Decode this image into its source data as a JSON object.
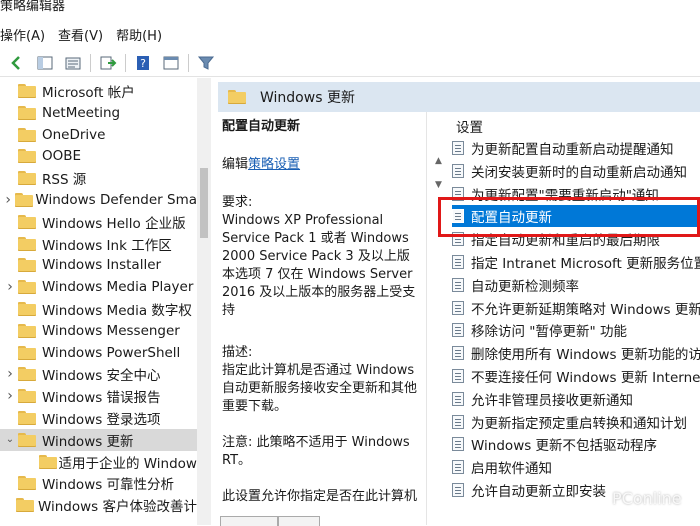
{
  "window": {
    "title": "策略编辑器"
  },
  "menu": [
    "操作(A)",
    "查看(V)",
    "帮助(H)"
  ],
  "toolbar": {
    "icons": [
      "back-icon",
      "forward-icon",
      "up-folder-icon",
      "show-hide-tree-icon",
      "export-list-icon",
      "help-icon",
      "properties-icon",
      "filter-icon"
    ]
  },
  "tree": {
    "items": [
      {
        "label": "Microsoft 帐户",
        "expandable": false,
        "indent": 1
      },
      {
        "label": "NetMeeting",
        "expandable": false,
        "indent": 1
      },
      {
        "label": "OneDrive",
        "expandable": false,
        "indent": 1
      },
      {
        "label": "OOBE",
        "expandable": false,
        "indent": 1
      },
      {
        "label": "RSS 源",
        "expandable": false,
        "indent": 1
      },
      {
        "label": "Windows Defender Sma",
        "expandable": true,
        "indent": 1
      },
      {
        "label": "Windows Hello 企业版",
        "expandable": false,
        "indent": 1
      },
      {
        "label": "Windows Ink 工作区",
        "expandable": false,
        "indent": 1
      },
      {
        "label": "Windows Installer",
        "expandable": false,
        "indent": 1
      },
      {
        "label": "Windows Media Player",
        "expandable": true,
        "indent": 1
      },
      {
        "label": "Windows Media 数字权",
        "expandable": false,
        "indent": 1
      },
      {
        "label": "Windows Messenger",
        "expandable": false,
        "indent": 1
      },
      {
        "label": "Windows PowerShell",
        "expandable": false,
        "indent": 1
      },
      {
        "label": "Windows 安全中心",
        "expandable": true,
        "indent": 1
      },
      {
        "label": "Windows 错误报告",
        "expandable": true,
        "indent": 1
      },
      {
        "label": "Windows 登录选项",
        "expandable": false,
        "indent": 1
      },
      {
        "label": "Windows 更新",
        "expandable": true,
        "expanded": true,
        "indent": 1,
        "selected": true
      },
      {
        "label": "适用于企业的 Window",
        "expandable": false,
        "indent": 2
      },
      {
        "label": "Windows 可靠性分析",
        "expandable": false,
        "indent": 1
      },
      {
        "label": "Windows 客户体验改善计",
        "expandable": false,
        "indent": 1
      }
    ]
  },
  "header": {
    "title": "Windows 更新"
  },
  "description": {
    "title": "配置自动更新",
    "edit_prefix": "编辑",
    "edit_link": "策略设置",
    "requirements_label": "要求:",
    "requirements_text": "Windows XP Professional Service Pack 1 或者 Windows 2000 Service Pack 3 及以上版本选项 7 仅在 Windows Server 2016 及以上版本的服务器上受支持",
    "description_label": "描述:",
    "description_text": "指定此计算机是否通过 Windows 自动更新服务接收安全更新和其他重要下载。",
    "note_text": "注意: 此策略不适用于 Windows RT。",
    "more_text": "此设置允许你指定是否在此计算机"
  },
  "list": {
    "column_header": "设置",
    "items": [
      "为更新配置自动重新启动提醒通知",
      "关闭安装更新时的自动重新启动通知",
      "为更新配置\"需要重新启动\"通知",
      "配置自动更新",
      "指定自动更新和重启的最后期限",
      "指定 Intranet Microsoft 更新服务位置",
      "自动更新检测频率",
      "不允许更新延期策略对 Windows 更新执",
      "移除访问 \"暂停更新\" 功能",
      "删除使用所有 Windows 更新功能的访",
      "不要连接任何 Windows 更新 Internet",
      "允许非管理员接收更新通知",
      "为更新指定预定重启转换和通知计划",
      "Windows 更新不包括驱动程序",
      "启用软件通知",
      "允许自动更新立即安装"
    ],
    "selected_index": 3
  },
  "watermark": "PConline",
  "colors": {
    "selection": "#0078d7",
    "header_bg": "#dbe6f1",
    "highlight_box": "#e01818",
    "folder": "#f3cd63"
  }
}
